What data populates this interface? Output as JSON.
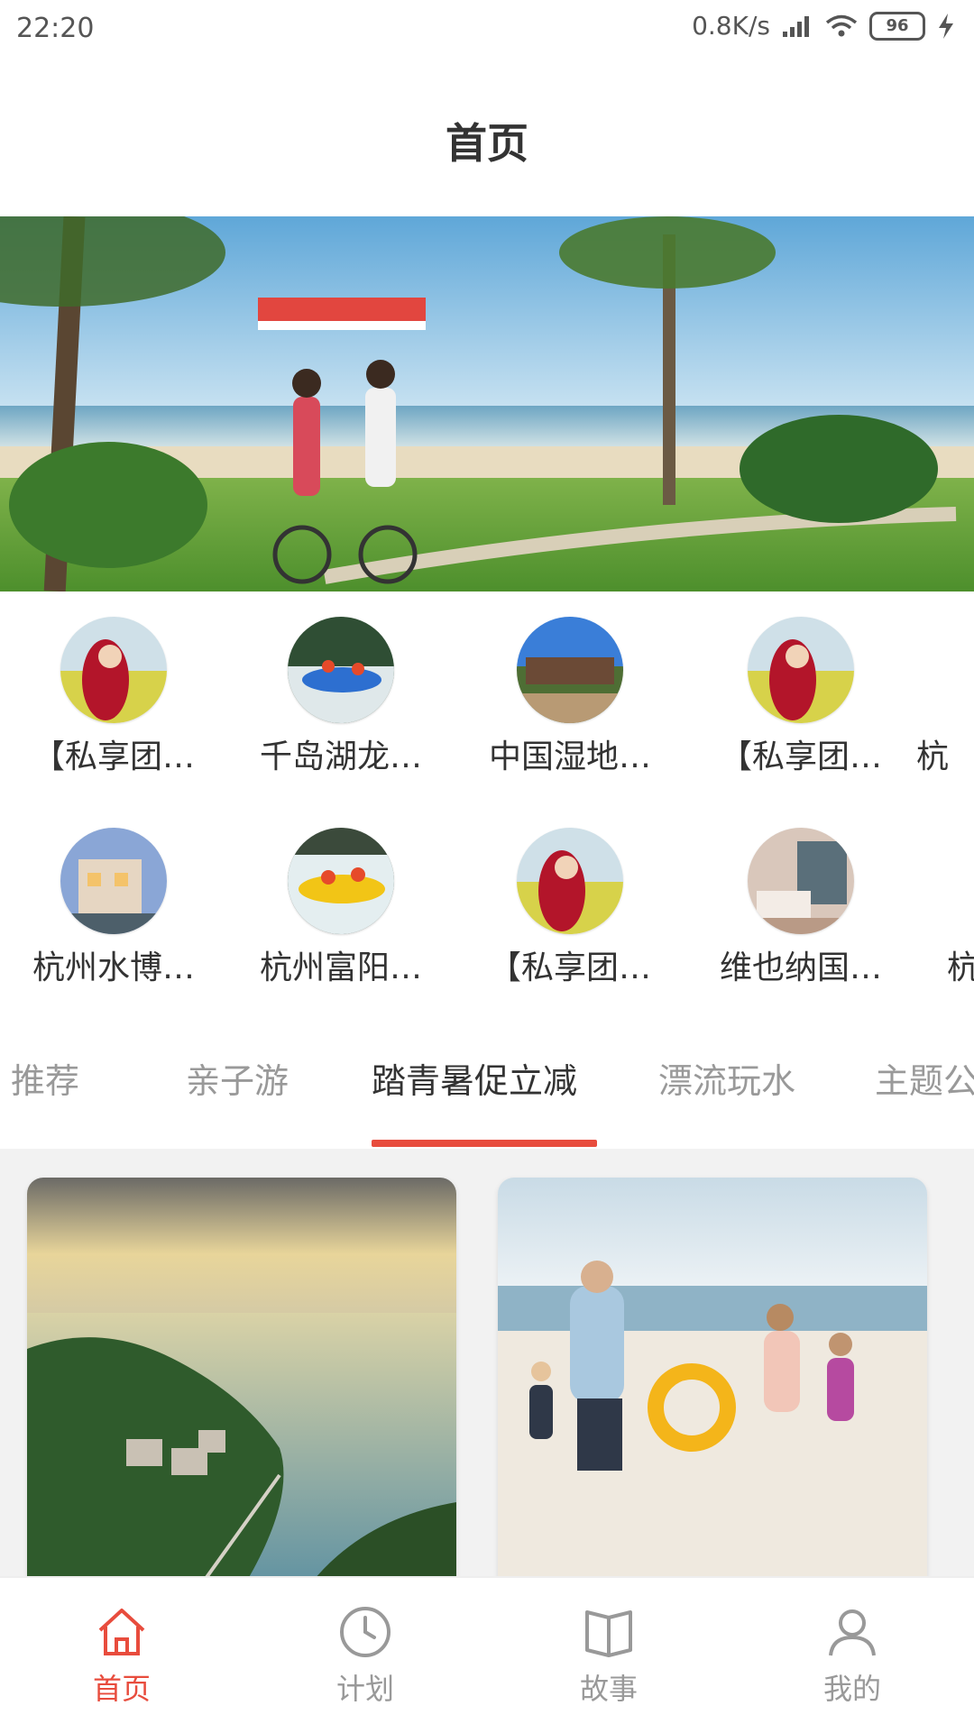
{
  "status_bar": {
    "time": "22:20",
    "network_speed": "0.8K/s",
    "battery": "96"
  },
  "header": {
    "title": "首页"
  },
  "banner": {
    "pages": 2,
    "active_page": 1
  },
  "quick_links": [
    {
      "label": "【私享团…",
      "image": "woman-red-scarf"
    },
    {
      "label": "千岛湖龙…",
      "image": "rafting"
    },
    {
      "label": "中国湿地…",
      "image": "wetland-sign"
    },
    {
      "label": "【私享团…",
      "image": "woman-red-scarf"
    },
    {
      "label": "杭",
      "image": "woman-red-scarf"
    },
    {
      "label": "杭州水博…",
      "image": "villa"
    },
    {
      "label": "杭州富阳…",
      "image": "rafting"
    },
    {
      "label": "【私享团…",
      "image": "woman-red-scarf"
    },
    {
      "label": "维也纳国…",
      "image": "hotel-room"
    },
    {
      "label": "杭",
      "image": "villa"
    }
  ],
  "tabs": [
    {
      "label": "推荐",
      "active": false
    },
    {
      "label": "亲子游",
      "active": false
    },
    {
      "label": "踏青暑促立减",
      "active": true
    },
    {
      "label": "漂流玩水",
      "active": false
    },
    {
      "label": "主题公",
      "active": false
    }
  ],
  "cards": [
    {
      "image": "lake-aerial"
    },
    {
      "image": "beach-family"
    }
  ],
  "bottom_nav": [
    {
      "label": "首页",
      "icon": "home-icon",
      "active": true
    },
    {
      "label": "计划",
      "icon": "clock-icon",
      "active": false
    },
    {
      "label": "故事",
      "icon": "book-icon",
      "active": false
    },
    {
      "label": "我的",
      "icon": "user-icon",
      "active": false
    }
  ],
  "colors": {
    "accent": "#e84c3d",
    "inactive": "#999999",
    "text": "#333333",
    "content_bg": "#f2f2f2"
  }
}
